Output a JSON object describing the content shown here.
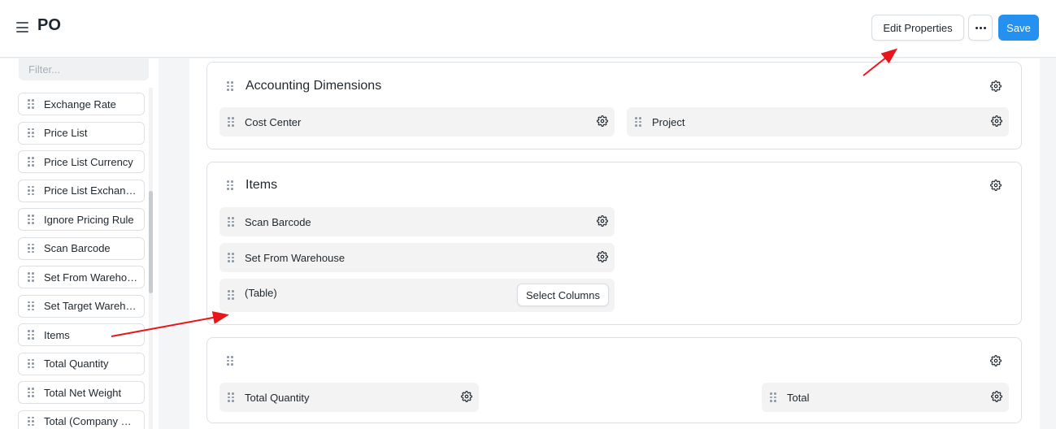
{
  "header": {
    "title": "PO",
    "edit_properties_label": "Edit Properties",
    "save_label": "Save"
  },
  "sidebar": {
    "filter_placeholder": "Filter...",
    "fields": [
      "Exchange Rate",
      "Price List",
      "Price List Currency",
      "Price List Exchange Rate",
      "Ignore Pricing Rule",
      "Scan Barcode",
      "Set From Warehouse",
      "Set Target Warehouse",
      "Items",
      "Total Quantity",
      "Total Net Weight",
      "Total (Company Currency)"
    ]
  },
  "sections": {
    "accounting": {
      "title": "Accounting Dimensions",
      "fields": [
        "Cost Center",
        "Project"
      ]
    },
    "items": {
      "title": "Items",
      "fields": [
        "Scan Barcode",
        "Set From Warehouse",
        "(Table)"
      ],
      "select_columns_label": "Select Columns"
    },
    "totals": {
      "title": "",
      "fields": [
        "Total Quantity",
        "Total"
      ]
    }
  },
  "colors": {
    "primary": "#2490ef",
    "annotation_arrow": "#e8161b"
  }
}
